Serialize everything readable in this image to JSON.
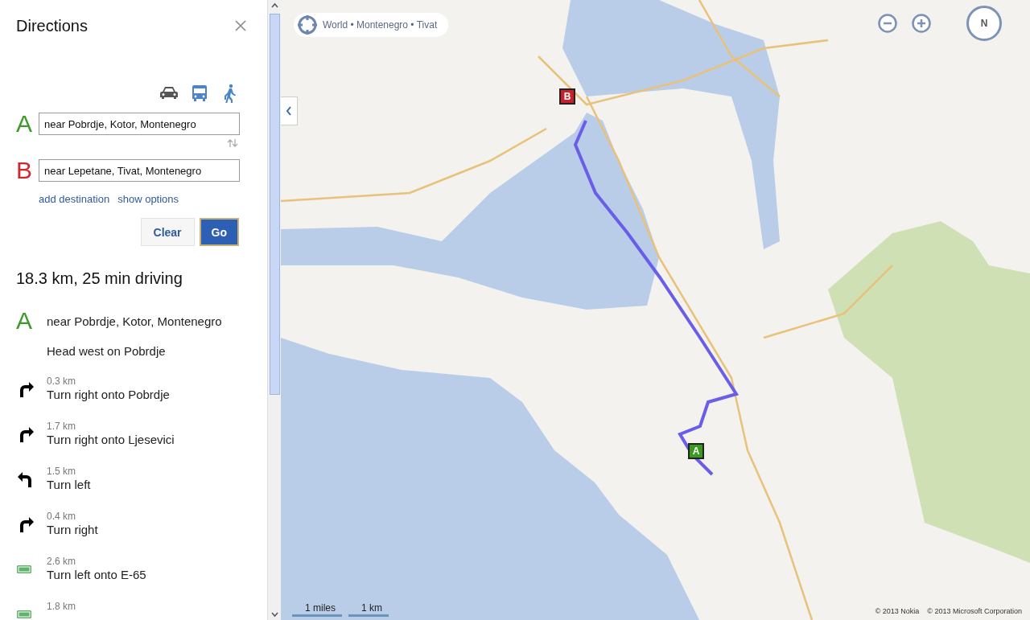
{
  "panel": {
    "title": "Directions",
    "modes": [
      {
        "kind": "car",
        "selected": true
      },
      {
        "kind": "bus",
        "selected": false
      },
      {
        "kind": "walk",
        "selected": false
      }
    ],
    "waypoints": [
      {
        "letter": "A",
        "color": "#3d9a2a",
        "value": "near Pobrdje, Kotor, Montenegro"
      },
      {
        "letter": "B",
        "color": "#d0262e",
        "value": "near Lepetane, Tivat, Montenegro"
      }
    ],
    "links": [
      "add destination",
      "show options"
    ],
    "buttons": [
      {
        "label": "Clear",
        "kind": "secondary"
      },
      {
        "label": "Go",
        "kind": "primary"
      }
    ],
    "summary": "18.3 km, 25 min driving",
    "start": {
      "letter": "A",
      "color": "#3d9a2a",
      "place": "near Pobrdje, Kotor, Montenegro",
      "instruction": "Head west on Pobrdje"
    },
    "steps": [
      {
        "kind": "right",
        "distance": "0.3 km",
        "instruction": "Turn right onto Pobrdje"
      },
      {
        "kind": "right",
        "distance": "1.7 km",
        "instruction": "Turn right onto Ljesevici"
      },
      {
        "kind": "left",
        "distance": "1.5 km",
        "instruction": "Turn left"
      },
      {
        "kind": "right",
        "distance": "0.4 km",
        "instruction": "Turn right"
      },
      {
        "kind": "road",
        "distance": "2.6 km",
        "instruction": "Turn left onto E-65"
      },
      {
        "kind": "road",
        "distance": "1.8 km"
      }
    ]
  },
  "map": {
    "breadcrumb": "World • Montenegro • Tivat",
    "compass": "N",
    "markers": [
      {
        "label": "B",
        "color": "#c8202c"
      },
      {
        "label": "A",
        "color": "#3a9a1e"
      }
    ],
    "scale": [
      "1 miles",
      "1 km"
    ],
    "copyright": [
      "© 2013 Nokia",
      "© 2013 Microsoft Corporation"
    ]
  }
}
